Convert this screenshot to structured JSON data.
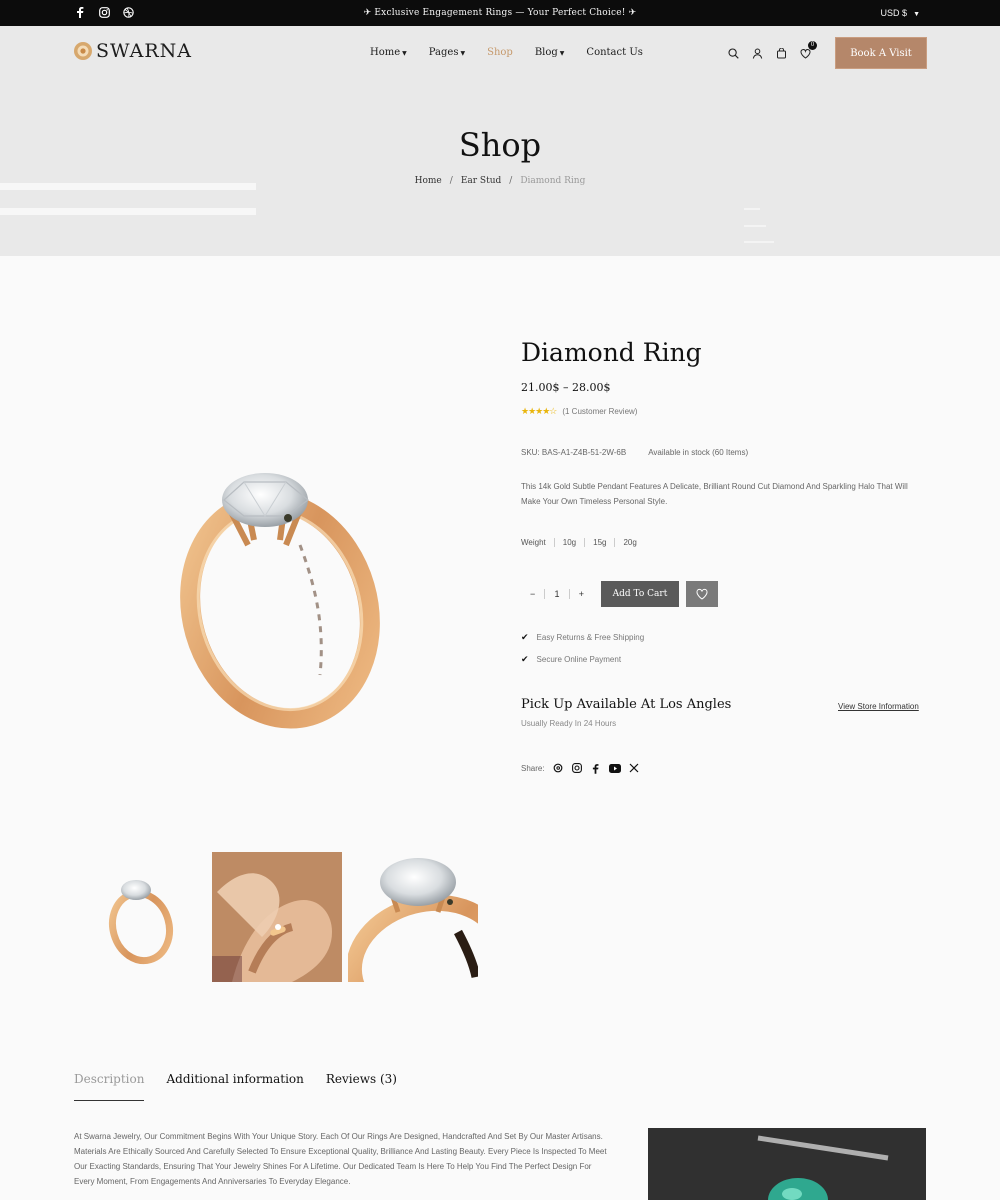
{
  "topbar": {
    "promo": "✈ Exclusive Engagement Rings — Your Perfect Choice! ✈",
    "currency": "USD $",
    "social_icons": [
      "facebook-icon",
      "instagram-icon",
      "dribbble-icon"
    ]
  },
  "header": {
    "logo_text": "SWARNA",
    "nav": [
      {
        "label": "Home",
        "dropdown": true,
        "active": false
      },
      {
        "label": "Pages",
        "dropdown": true,
        "active": false
      },
      {
        "label": "Shop",
        "dropdown": false,
        "active": true
      },
      {
        "label": "Blog",
        "dropdown": true,
        "active": false
      },
      {
        "label": "Contact Us",
        "dropdown": false,
        "active": false
      }
    ],
    "cart_count": "0",
    "cta_label": "Book A Visit",
    "accent_color": "#b5876a"
  },
  "hero": {
    "title": "Shop",
    "breadcrumbs": [
      "Home",
      "Ear Stud",
      "Diamond Ring"
    ]
  },
  "product": {
    "title": "Diamond Ring",
    "price": "21.00$ – 28.00$",
    "rating": 4,
    "reviews_label": "(1 Customer Review)",
    "sku": "SKU: BAS-A1-Z4B-51-2W-6B",
    "stock": "Available in stock (60 Items)",
    "description": "This 14k Gold Subtle Pendant Features A Delicate, Brilliant Round Cut Diamond And Sparkling Halo That Will Make Your Own Timeless Personal Style.",
    "weight_label": "Weight",
    "weights": [
      "10g",
      "15g",
      "20g"
    ],
    "qty_minus": "−",
    "qty_value": "1",
    "qty_plus": "+",
    "add_to_cart": "Add To Cart",
    "perks": [
      "Easy Returns & Free Shipping",
      "Secure Online Payment"
    ],
    "pickup_title": "Pick Up Available At Los Angles",
    "pickup_sub": "Usually Ready In 24 Hours",
    "store_link": "View Store Information",
    "share_label": "Share:",
    "share_icons": [
      "threads-icon",
      "instagram-icon",
      "facebook-icon",
      "youtube-icon",
      "x-icon"
    ]
  },
  "tabs": [
    {
      "label": "Description",
      "active": true
    },
    {
      "label": "Additional information",
      "active": false
    },
    {
      "label": "Reviews (3)",
      "active": false
    }
  ],
  "description_text": "At Swarna Jewelry, Our Commitment Begins With Your Unique Story. Each Of Our Rings Are Designed, Handcrafted And Set By Our Master Artisans. Materials Are Ethically Sourced And Carefully Selected To Ensure Exceptional Quality, Brilliance And Lasting Beauty. Every Piece Is Inspected To Meet Our Exacting Standards, Ensuring That Your Jewelry Shines For A Lifetime. Our Dedicated Team Is Here To Help You Find The Perfect Design For Every Moment, From Engagements And Anniversaries To Everyday Elegance."
}
